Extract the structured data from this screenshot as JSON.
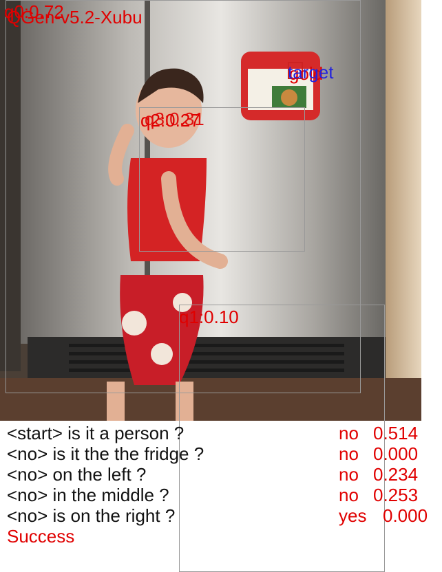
{
  "title": "QGen-v5.2-Xubu",
  "box_labels": {
    "q0": "q0:0.72",
    "q1": "q1:0.10",
    "q23": "q2:0.27",
    "q3": "q3:0.31",
    "target": "target",
    "target2": "gold"
  },
  "dialogue": [
    {
      "question": "<start> is it a person ?",
      "answer": "no",
      "score": "0.514"
    },
    {
      "question": "<no> is it the the fridge ?",
      "answer": "no",
      "score": "0.000"
    },
    {
      "question": "<no> on the left ?",
      "answer": "no",
      "score": "0.234"
    },
    {
      "question": "<no> in the middle ?",
      "answer": "no",
      "score": "0.253"
    },
    {
      "question": "<no> is on the right ?",
      "answer": "yes",
      "score": "0.000"
    }
  ],
  "result": "Success",
  "colors": {
    "label": "#e00000",
    "target": "#2222dd",
    "box": "#999999"
  }
}
